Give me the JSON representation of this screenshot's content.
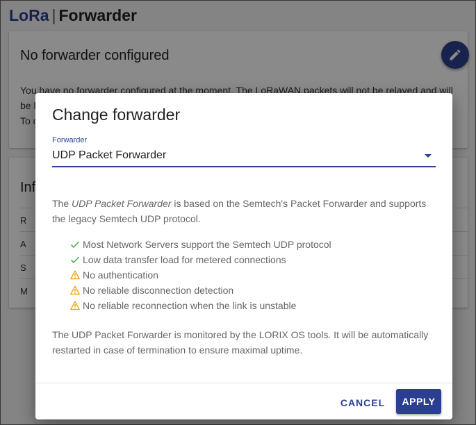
{
  "page": {
    "brand": "LoRa",
    "separator": "|",
    "title": "Forwarder"
  },
  "background_card": {
    "title": "No forwarder configured",
    "text_line1": "You have no forwarder configured at the moment. The LoRaWAN packets will not be relayed and will",
    "text_line2": "be l",
    "text_line3": "To c"
  },
  "info_card": {
    "title_partial": "Inf",
    "rows": [
      "R",
      "A",
      "S",
      "M"
    ]
  },
  "fab": {
    "icon": "pencil-icon"
  },
  "dialog": {
    "title": "Change forwarder",
    "field_label": "Forwarder",
    "selected_value": "UDP Packet Forwarder",
    "desc_prefix": "The ",
    "desc_emphasis": "UDP Packet Forwarder",
    "desc_suffix": " is based on the Semtech's Packet Forwarder and supports the legacy Semtech UDP protocol.",
    "features": [
      {
        "type": "check",
        "icon": "check-icon",
        "text": "Most Network Servers support the Semtech UDP protocol"
      },
      {
        "type": "check",
        "icon": "check-icon",
        "text": "Low data transfer load for metered connections"
      },
      {
        "type": "warning",
        "icon": "warning-icon",
        "text": "No authentication"
      },
      {
        "type": "warning",
        "icon": "warning-icon",
        "text": "No reliable disconnection detection"
      },
      {
        "type": "warning",
        "icon": "warning-icon",
        "text": "No reliable reconnection when the link is unstable"
      }
    ],
    "footer_text": "The UDP Packet Forwarder is monitored by the LORIX OS tools. It will be automatically restarted in case of termination to ensure maximal uptime.",
    "cancel_label": "CANCEL",
    "apply_label": "APPLY"
  },
  "colors": {
    "primary": "#2b3f92",
    "check": "#4caf50",
    "warning": "#f0a30a"
  }
}
